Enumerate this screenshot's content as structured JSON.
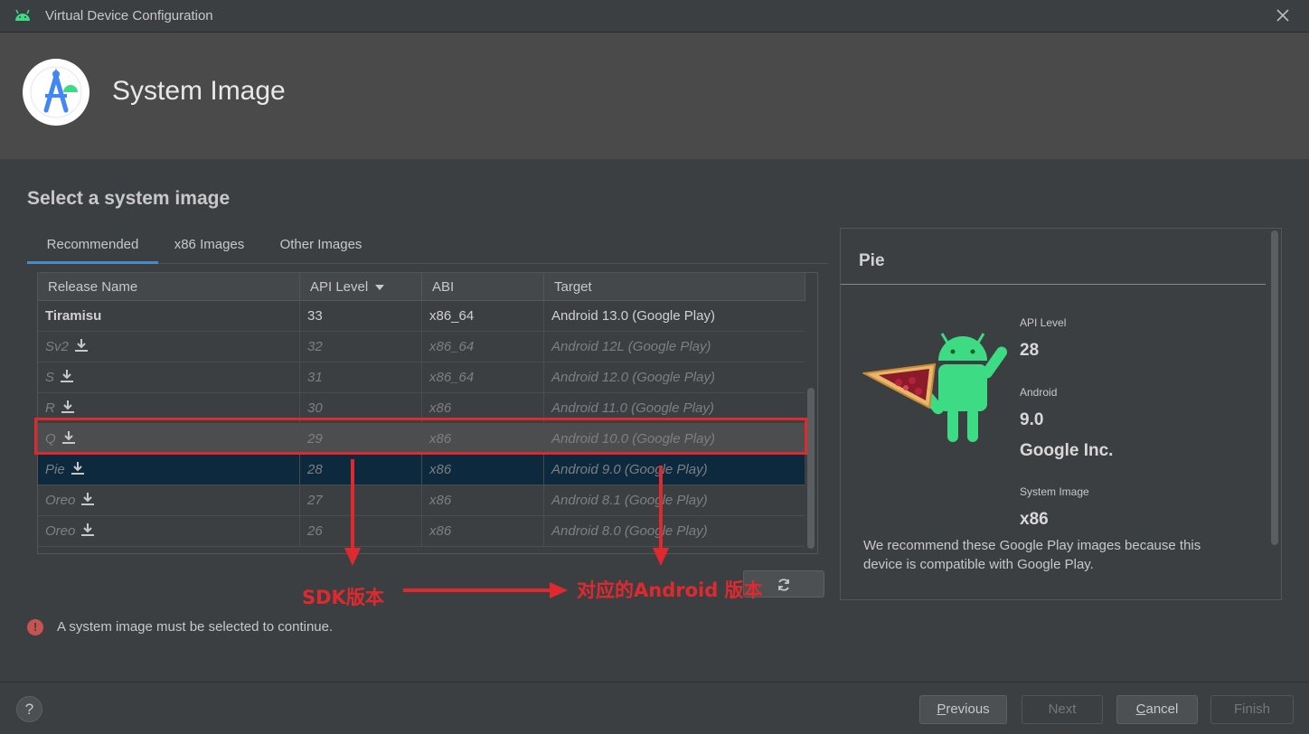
{
  "window": {
    "title": "Virtual Device Configuration"
  },
  "header": {
    "title": "System Image"
  },
  "section": {
    "title": "Select a system image"
  },
  "tabs": [
    {
      "label": "Recommended",
      "active": true
    },
    {
      "label": "x86 Images",
      "active": false
    },
    {
      "label": "Other Images",
      "active": false
    }
  ],
  "table": {
    "columns": [
      "Release Name",
      "API Level",
      "ABI",
      "Target"
    ],
    "rows": [
      {
        "name": "Tiramisu",
        "api": "33",
        "abi": "x86_64",
        "target": "Android 13.0 (Google Play)",
        "download": false
      },
      {
        "name": "Sv2",
        "api": "32",
        "abi": "x86_64",
        "target": "Android 12L (Google Play)",
        "download": true
      },
      {
        "name": "S",
        "api": "31",
        "abi": "x86_64",
        "target": "Android 12.0 (Google Play)",
        "download": true
      },
      {
        "name": "R",
        "api": "30",
        "abi": "x86",
        "target": "Android 11.0 (Google Play)",
        "download": true
      },
      {
        "name": "Q",
        "api": "29",
        "abi": "x86",
        "target": "Android 10.0 (Google Play)",
        "download": true
      },
      {
        "name": "Pie",
        "api": "28",
        "abi": "x86",
        "target": "Android 9.0 (Google Play)",
        "download": true
      },
      {
        "name": "Oreo",
        "api": "27",
        "abi": "x86",
        "target": "Android 8.1 (Google Play)",
        "download": true
      },
      {
        "name": "Oreo",
        "api": "26",
        "abi": "x86",
        "target": "Android 8.0 (Google Play)",
        "download": true
      }
    ]
  },
  "details": {
    "title": "Pie",
    "api_label": "API Level",
    "api_value": "28",
    "android_label": "Android",
    "android_value": "9.0",
    "vendor": "Google Inc.",
    "image_label": "System Image",
    "image_value": "x86",
    "description": "We recommend these Google Play images because this device is compatible with Google Play."
  },
  "error": {
    "message": "A system image must be selected to continue."
  },
  "footer": {
    "help": "?",
    "previous": {
      "prefix": "",
      "mnemonic": "P",
      "rest": "revious"
    },
    "next": "Next",
    "cancel": {
      "prefix": "",
      "mnemonic": "C",
      "rest": "ancel"
    },
    "finish": "Finish"
  },
  "annotations": {
    "sdk_label": "SDK版本",
    "android_label": "对应的Android 版本"
  },
  "colors": {
    "accent": "#4a88c7",
    "selection": "#0d293e",
    "annotation": "#e0292f",
    "error": "#c75450"
  }
}
